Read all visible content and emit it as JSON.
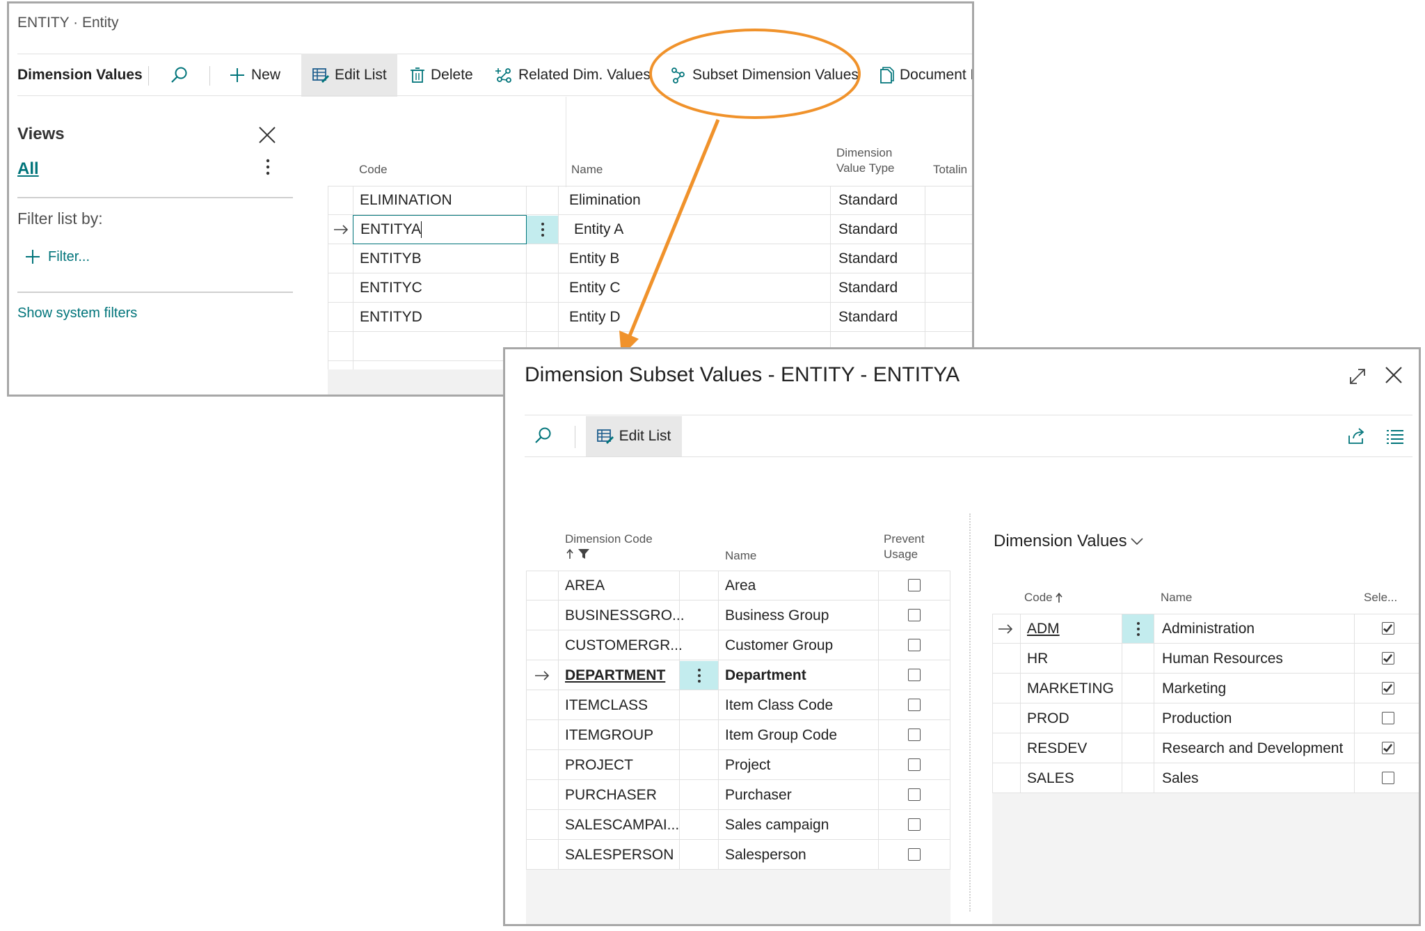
{
  "back_window": {
    "caption": "ENTITY · Entity",
    "toolbar": {
      "title": "Dimension Values",
      "new_label": "New",
      "edit_list_label": "Edit List",
      "delete_label": "Delete",
      "related_label": "Related Dim. Values",
      "subset_label": "Subset Dimension Values",
      "document_label": "Document L"
    },
    "views": {
      "title": "Views",
      "all_label": "All",
      "filter_label": "Filter list by:",
      "filter_add_label": "Filter...",
      "show_system_filters": "Show system filters"
    },
    "grid": {
      "headers": {
        "code": "Code",
        "name": "Name",
        "type_line1": "Dimension",
        "type_line2": "Value Type",
        "totaling": "Totalin"
      },
      "rows": [
        {
          "code": "ELIMINATION",
          "name": "Elimination",
          "type": "Standard"
        },
        {
          "code": "ENTITYA",
          "name": "Entity A",
          "type": "Standard"
        },
        {
          "code": "ENTITYB",
          "name": "Entity B",
          "type": "Standard"
        },
        {
          "code": "ENTITYC",
          "name": "Entity C",
          "type": "Standard"
        },
        {
          "code": "ENTITYD",
          "name": "Entity D",
          "type": "Standard"
        }
      ]
    }
  },
  "dialog": {
    "title": "Dimension Subset Values - ENTITY - ENTITYA",
    "edit_list_label": "Edit List",
    "left_grid": {
      "headers": {
        "dim_code": "Dimension Code",
        "name": "Name",
        "prevent_line1": "Prevent",
        "prevent_line2": "Usage"
      },
      "rows": [
        {
          "code": "AREA",
          "name": "Area",
          "prevent": false
        },
        {
          "code": "BUSINESSGRO...",
          "name": "Business Group",
          "prevent": false
        },
        {
          "code": "CUSTOMERGR...",
          "name": "Customer Group",
          "prevent": false
        },
        {
          "code": "DEPARTMENT",
          "name": "Department",
          "prevent": false
        },
        {
          "code": "ITEMCLASS",
          "name": "Item Class Code",
          "prevent": false
        },
        {
          "code": "ITEMGROUP",
          "name": "Item Group Code",
          "prevent": false
        },
        {
          "code": "PROJECT",
          "name": "Project",
          "prevent": false
        },
        {
          "code": "PURCHASER",
          "name": "Purchaser",
          "prevent": false
        },
        {
          "code": "SALESCAMPAI...",
          "name": "Sales campaign",
          "prevent": false
        },
        {
          "code": "SALESPERSON",
          "name": "Salesperson",
          "prevent": false
        }
      ]
    },
    "right_panel": {
      "title": "Dimension Values",
      "headers": {
        "code": "Code",
        "name": "Name",
        "select": "Sele..."
      },
      "rows": [
        {
          "code": "ADM",
          "name": "Administration",
          "selected": true
        },
        {
          "code": "HR",
          "name": "Human Resources",
          "selected": true
        },
        {
          "code": "MARKETING",
          "name": "Marketing",
          "selected": true
        },
        {
          "code": "PROD",
          "name": "Production",
          "selected": false
        },
        {
          "code": "RESDEV",
          "name": "Research and Development",
          "selected": true
        },
        {
          "code": "SALES",
          "name": "Sales",
          "selected": false
        }
      ]
    }
  },
  "colors": {
    "accent": "#00747a",
    "annotation": "#f0922b",
    "selected_cell": "#c3ecee"
  }
}
